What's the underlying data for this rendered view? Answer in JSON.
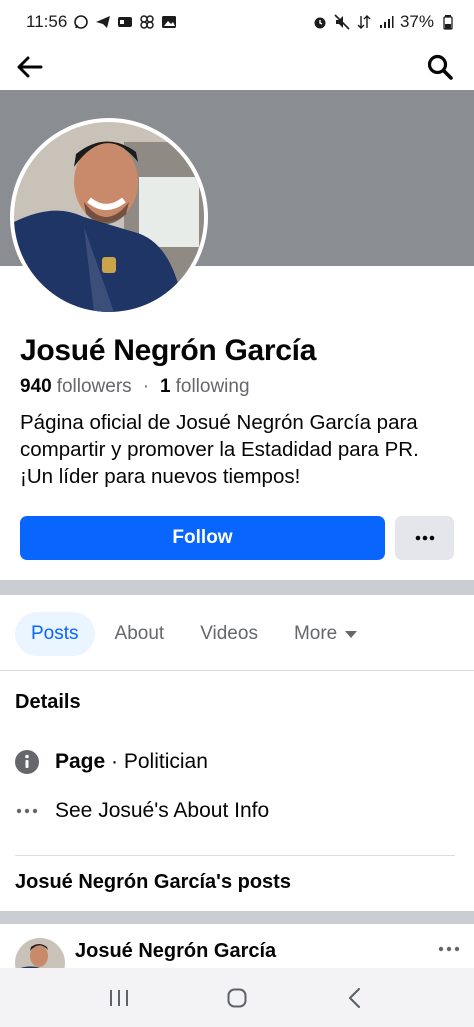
{
  "status": {
    "time": "11:56",
    "battery": "37%",
    "icons_left": [
      "whatsapp-icon",
      "telegram-icon",
      "messenger-icon",
      "pinwheel-icon",
      "gallery-icon"
    ],
    "icons_right": [
      "alarm-icon",
      "mute-icon",
      "data-icon",
      "signal-icon",
      "battery-icon"
    ]
  },
  "header": {
    "back_icon": "back-arrow-icon",
    "search_icon": "search-icon"
  },
  "profile": {
    "name": "Josué Negrón García",
    "followers_count": "940",
    "followers_label": "followers",
    "separator": "·",
    "following_count": "1",
    "following_label": "following",
    "bio": "Página oficial de Josué Negrón García para compartir y promover la Estadidad para PR. ¡Un líder para nuevos tiempos!",
    "follow_label": "Follow",
    "colors": {
      "accent": "#0866ff",
      "cover": "#8a8d91"
    }
  },
  "tabs": [
    {
      "label": "Posts",
      "active": true
    },
    {
      "label": "About",
      "active": false
    },
    {
      "label": "Videos",
      "active": false
    },
    {
      "label": "More",
      "active": false
    }
  ],
  "details": {
    "title": "Details",
    "page_label": "Page",
    "page_category": " · Politician",
    "about_link": "See Josué's About Info"
  },
  "posts": {
    "title": "Josué Negrón García's posts",
    "first_post_author": "Josué Negrón García"
  },
  "nav": {
    "recents_icon": "recents-icon",
    "home_icon": "home-icon",
    "back_icon": "nav-back-icon"
  }
}
